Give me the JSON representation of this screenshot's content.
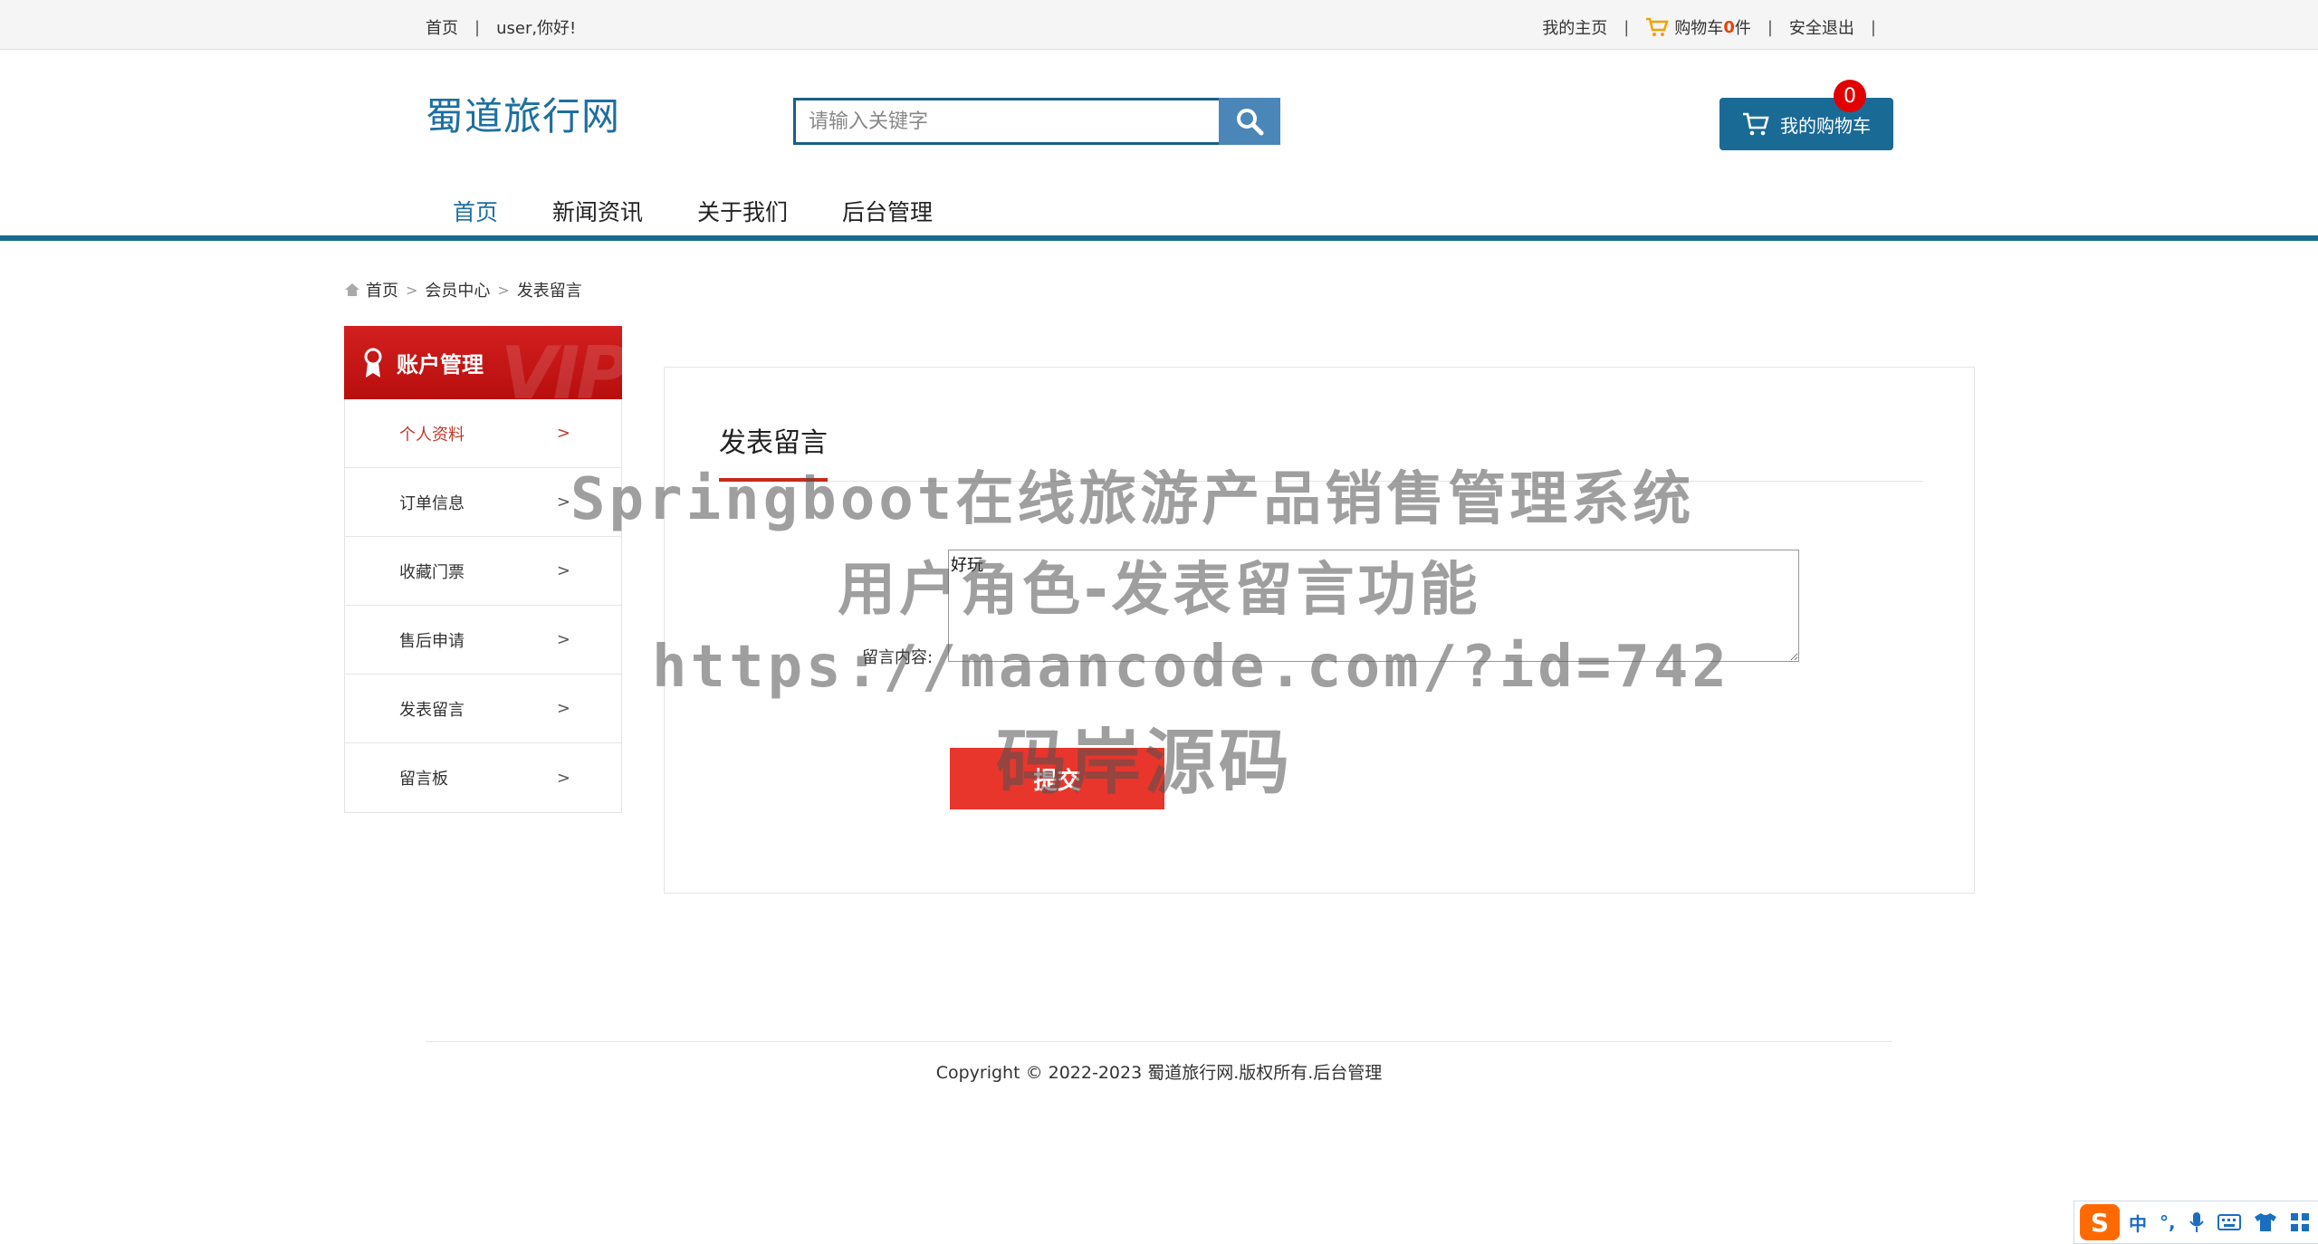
{
  "topbar": {
    "home": "首页",
    "greeting": "user,你好!",
    "my_home": "我的主页",
    "cart_prefix": "购物车",
    "cart_count": "0",
    "cart_suffix": "件",
    "logout": "安全退出",
    "sep": "|"
  },
  "header": {
    "logo": "蜀道旅行网",
    "search_placeholder": "请输入关键字",
    "cart_button": "我的购物车",
    "cart_badge": "0"
  },
  "nav": {
    "items": [
      "首页",
      "新闻资讯",
      "关于我们",
      "后台管理"
    ],
    "active_color": "#1d6fa0"
  },
  "breadcrumb": {
    "items": [
      "首页",
      "会员中心",
      "发表留言"
    ],
    "separator": ">"
  },
  "sidebar": {
    "title": "账户管理",
    "vip": "VIP",
    "items": [
      {
        "label": "个人资料",
        "arrow": ">"
      },
      {
        "label": "订单信息",
        "arrow": ">"
      },
      {
        "label": "收藏门票",
        "arrow": ">"
      },
      {
        "label": "售后申请",
        "arrow": ">"
      },
      {
        "label": "发表留言",
        "arrow": ">"
      },
      {
        "label": "留言板",
        "arrow": ">"
      }
    ],
    "active_index": 0
  },
  "panel": {
    "title": "发表留言",
    "field_label": "留言内容:",
    "textarea_value": "好玩",
    "submit_label": "提交"
  },
  "watermark": {
    "line1": "Springboot在线旅游产品销售管理系统",
    "line2": "用户角色-发表留言功能",
    "line3": "https://maancode.com/?id=742",
    "line4": "码岸源码"
  },
  "footer": {
    "copyright": "Copyright © 2022-2023 蜀道旅行网.版权所有.后台管理"
  },
  "ime": {
    "logo": "S",
    "lang": "中",
    "punct": "°,"
  },
  "colors": {
    "brand_blue": "#1a6a96",
    "accent_red": "#e8362c",
    "sidebar_red": "#c81717"
  }
}
